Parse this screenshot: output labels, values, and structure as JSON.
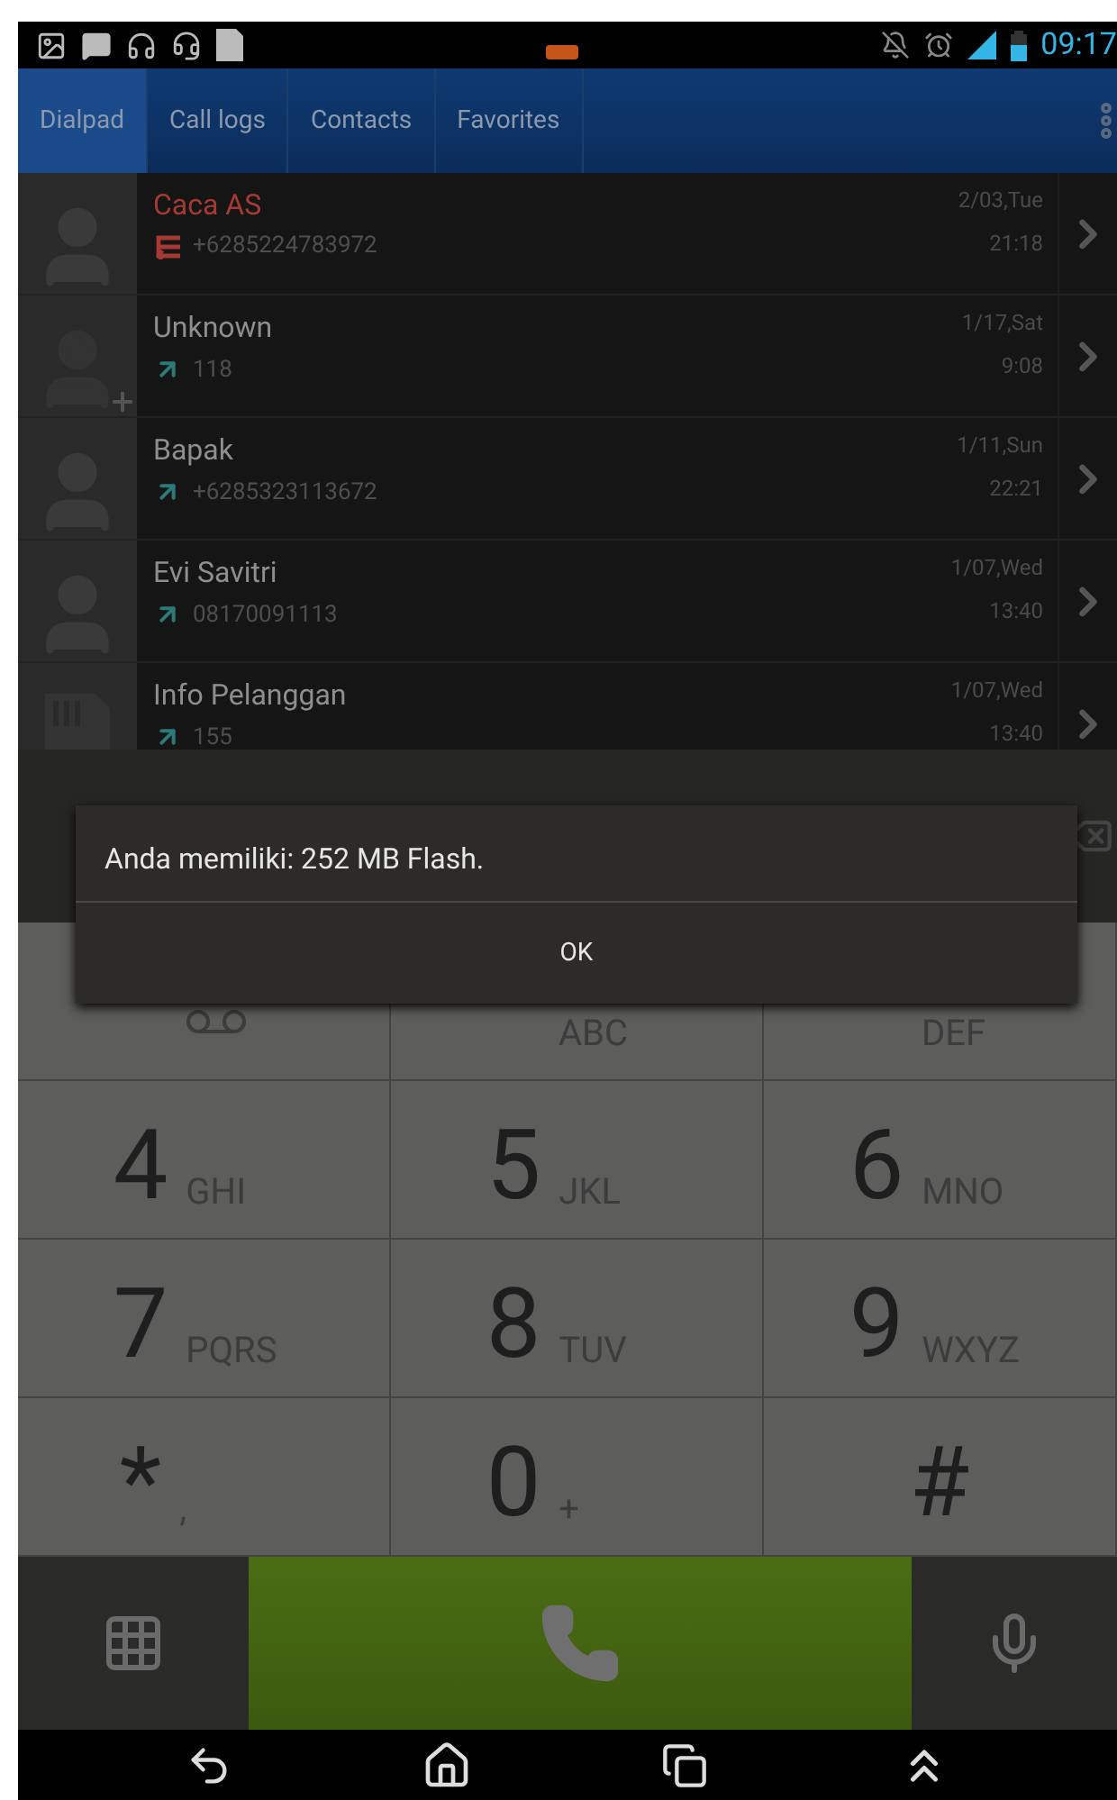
{
  "status_bar": {
    "time": "09:17"
  },
  "tabs": [
    {
      "label": "Dialpad",
      "selected": true
    },
    {
      "label": "Call logs",
      "selected": false
    },
    {
      "label": "Contacts",
      "selected": false
    },
    {
      "label": "Favorites",
      "selected": false
    }
  ],
  "call_logs": [
    {
      "name": "Caca AS",
      "kind": "missed",
      "avatar": {
        "kind": "person"
      },
      "number": "+6285224783972",
      "date": "2/03,Tue",
      "time": "21:18"
    },
    {
      "name": "Unknown",
      "kind": "outgoing",
      "avatar": {
        "kind": "add"
      },
      "number": "118",
      "date": "1/17,Sat",
      "time": "9:08"
    },
    {
      "name": "Bapak",
      "kind": "outgoing",
      "avatar": {
        "kind": "person"
      },
      "number": "+6285323113672",
      "date": "1/11,Sun",
      "time": "22:21"
    },
    {
      "name": "Evi Savitri",
      "kind": "outgoing",
      "avatar": {
        "kind": "person"
      },
      "number": "08170091113",
      "date": "1/07,Wed",
      "time": "13:40"
    },
    {
      "name": "Info Pelanggan",
      "kind": "outgoing",
      "avatar": {
        "kind": "sim"
      },
      "number": "155",
      "date": "1/07,Wed",
      "time": "13:40"
    }
  ],
  "dialog": {
    "message": "Anda memiliki: 252 MB Flash.",
    "button": "OK"
  },
  "keys": [
    {
      "kind": "voicemail"
    },
    {
      "kind": "letters",
      "sub": "ABC"
    },
    {
      "kind": "letters",
      "sub": "DEF"
    },
    {
      "digit": "4",
      "kind": "letters",
      "sub": "GHI"
    },
    {
      "digit": "5",
      "kind": "letters",
      "sub": "JKL"
    },
    {
      "digit": "6",
      "kind": "letters",
      "sub": "MNO"
    },
    {
      "digit": "7",
      "kind": "letters",
      "sub": "PQRS"
    },
    {
      "digit": "8",
      "kind": "letters",
      "sub": "TUV"
    },
    {
      "digit": "9",
      "kind": "letters",
      "sub": "WXYZ"
    },
    {
      "digit": "*",
      "kind": "letters",
      "sub": ","
    },
    {
      "digit": "0",
      "kind": "letters",
      "sub": "+"
    },
    {
      "digit": "#",
      "kind": "plain"
    }
  ]
}
